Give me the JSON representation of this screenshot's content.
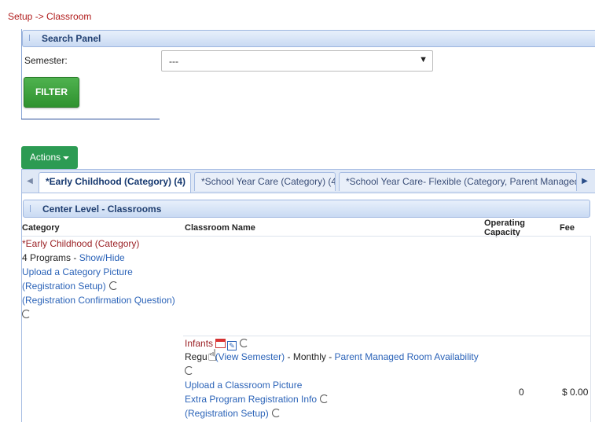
{
  "breadcrumb": "Setup -> Classroom",
  "search_panel": {
    "title": "Search Panel",
    "semester_label": "Semester:",
    "semester_value": "---",
    "filter_label": "FILTER"
  },
  "actions_label": "Actions",
  "tabs": [
    {
      "label": "*Early Childhood (Category) (4)"
    },
    {
      "label": "*School Year Care (Category) (4)"
    },
    {
      "label": "*School Year Care- Flexible (Category, Parent Managed Roo"
    }
  ],
  "section": {
    "title": "Center Level - Classrooms",
    "columns": {
      "category": "Category",
      "classroom_name": "Classroom Name",
      "operating_capacity_line1": "Operating",
      "operating_capacity_line2": "Capacity",
      "fee": "Fee"
    }
  },
  "category_cell": {
    "name": "*Early Childhood (Category)",
    "programs_prefix": "4 Programs - ",
    "show_hide": "Show/Hide",
    "upload_picture": "Upload a Category Picture",
    "registration_setup": "(Registration Setup)",
    "confirmation_question": "(Registration Confirmation Question)"
  },
  "classroom_row": {
    "name": "Infants",
    "regular_prefix": "Regu",
    "view_semester": "(View Semester)",
    "monthly": " - Monthly - ",
    "parent_managed": "Parent Managed Room Availability",
    "upload_picture": "Upload a Classroom Picture",
    "extra_info": "Extra Program Registration Info",
    "registration_setup": "(Registration Setup)",
    "capacity": "0",
    "fee": "$ 0.00"
  }
}
